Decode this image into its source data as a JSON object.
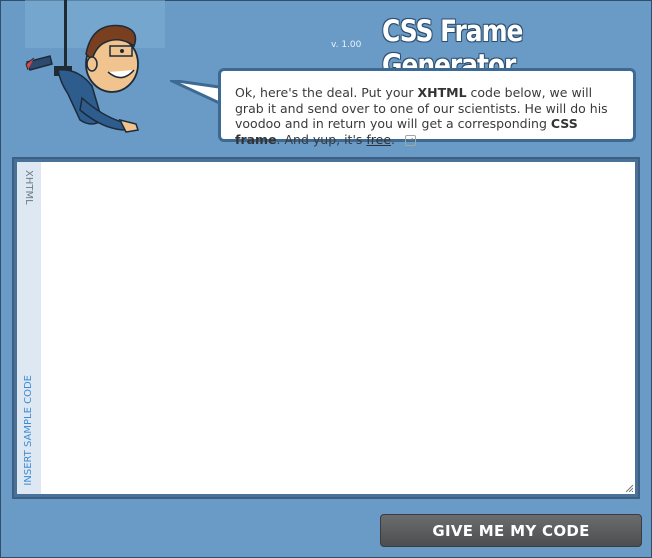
{
  "header": {
    "title": "CSS Frame Generator",
    "version": "v. 1.00"
  },
  "bubble": {
    "text_1": "Ok, here's the deal. Put your ",
    "text_2": "XHTML",
    "text_3": " code below, we will grab it and send over to one of our scientists. He will do his voodoo and in return you will get a corresponding ",
    "text_4": "CSS frame",
    "text_5": ". And yup, it's ",
    "text_6": "free",
    "text_7": "."
  },
  "editor": {
    "label": "XHTML",
    "sample_link": "INSERT SAMPLE CODE",
    "value": ""
  },
  "submit": {
    "label": "GIVE ME MY CODE"
  },
  "icons": [
    "mascot-icon",
    "arrow-right-icon",
    "resize-grip-icon"
  ],
  "colors": {
    "background": "#6a9bc6",
    "button": "#58595b",
    "link": "#3e8ad4"
  }
}
